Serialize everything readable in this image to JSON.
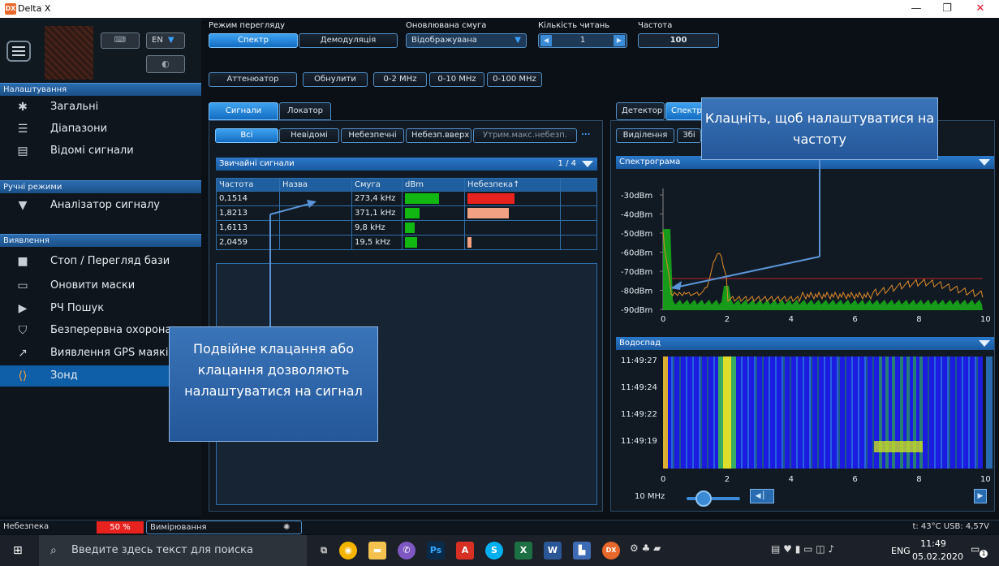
{
  "window": {
    "app_icon": "DX",
    "title": "Delta X",
    "minimize": "—",
    "restore": "❐",
    "close": "✕"
  },
  "sidebar": {
    "lang": "EN",
    "sections": [
      {
        "title": "Налаштування",
        "items": [
          "Загальні",
          "Діапазони",
          "Відомі сигнали"
        ]
      },
      {
        "title": "Ручні режими",
        "items": [
          "Аналізатор сигналу"
        ]
      },
      {
        "title": "Виявлення",
        "items": [
          "Стоп / Перегляд бази",
          "Оновити маски",
          "РЧ Пошук",
          "Безперервна охорона",
          "Виявлення GPS маяків",
          "Зонд"
        ]
      }
    ],
    "active_item": "Зонд"
  },
  "toolbar": {
    "view_mode_label": "Режим перегляду",
    "view_modes": [
      "Спектр",
      "Демодуляція"
    ],
    "updated_band_label": "Оновлювана смуга",
    "updated_band_value": "Відображувана",
    "read_count_label": "Кількість читань",
    "read_count_value": "1",
    "freq_label": "Частота",
    "freq_value": "100",
    "row2": [
      "Аттенюатор",
      "Обнулити",
      "0-2 MHz",
      "0-10 MHz",
      "0-100 MHz"
    ]
  },
  "left_panel": {
    "tabs": [
      "Сигнали",
      "Локатор"
    ],
    "filters": [
      "Всі",
      "Невідомі",
      "Небезпечні",
      "Небезп.вверх",
      "Утрим.макс.небезп.",
      "..."
    ],
    "table_title": "Звичайні сигнали",
    "page": "1 / 4",
    "columns": [
      "Частота",
      "Назва",
      "Смуга",
      "dBm",
      "Небезпека↑"
    ],
    "rows": [
      {
        "freq": "0,1514",
        "name": "",
        "band": "273,4 kHz",
        "dbm": 0.7,
        "danger": 0.9,
        "danger_color": "#e8231f"
      },
      {
        "freq": "1,8213",
        "name": "",
        "band": "371,1 kHz",
        "dbm": 0.3,
        "danger": 0.8,
        "danger_color": "#f2a182"
      },
      {
        "freq": "1,6113",
        "name": "",
        "band": "9,8 kHz",
        "dbm": 0.2,
        "danger": 0.0,
        "danger_color": "#f2a182"
      },
      {
        "freq": "2,0459",
        "name": "",
        "band": "19,5 kHz",
        "dbm": 0.25,
        "danger": 0.08,
        "danger_color": "#f2a182"
      }
    ]
  },
  "right_panel": {
    "tabs": [
      "Детектор",
      "Спектр"
    ],
    "sub_buttons": [
      "Виділення",
      "Збі"
    ],
    "spectrogram_title": "Спектрограма",
    "y_ticks": [
      "-30dBm",
      "-40dBm",
      "-50dBm",
      "-60dBm",
      "-70dBm",
      "-80dBm",
      "-90dBm"
    ],
    "x_ticks": [
      "0",
      "2",
      "4",
      "6",
      "8",
      "10"
    ],
    "waterfall_title": "Водоспад",
    "time_ticks": [
      "11:49:27",
      "11:49:24",
      "11:49:22",
      "11:49:19"
    ],
    "zoom_label": "10 MHz"
  },
  "callouts": {
    "top": "Клацніть, щоб налаштуватися на частоту",
    "left": "Подвійне клацання або клацання дозволяють налаштуватися на сигнал"
  },
  "status": {
    "danger_label": "Небезпека",
    "danger_value": "50 %",
    "measure_label": "Вимірювання",
    "temp": "t: 43°C  USB: 4,57V"
  },
  "taskbar": {
    "search_placeholder": "Введите здесь текст для поиска",
    "lang": "ENG",
    "time": "11:49",
    "date": "05.02.2020",
    "notif_count": "1"
  },
  "colors": {
    "accent": "#1e7fd6",
    "waterfall_bg": "#1a1ad6",
    "spectrum_orange": "#e08a2a",
    "spectrum_green": "#1fb81f"
  }
}
